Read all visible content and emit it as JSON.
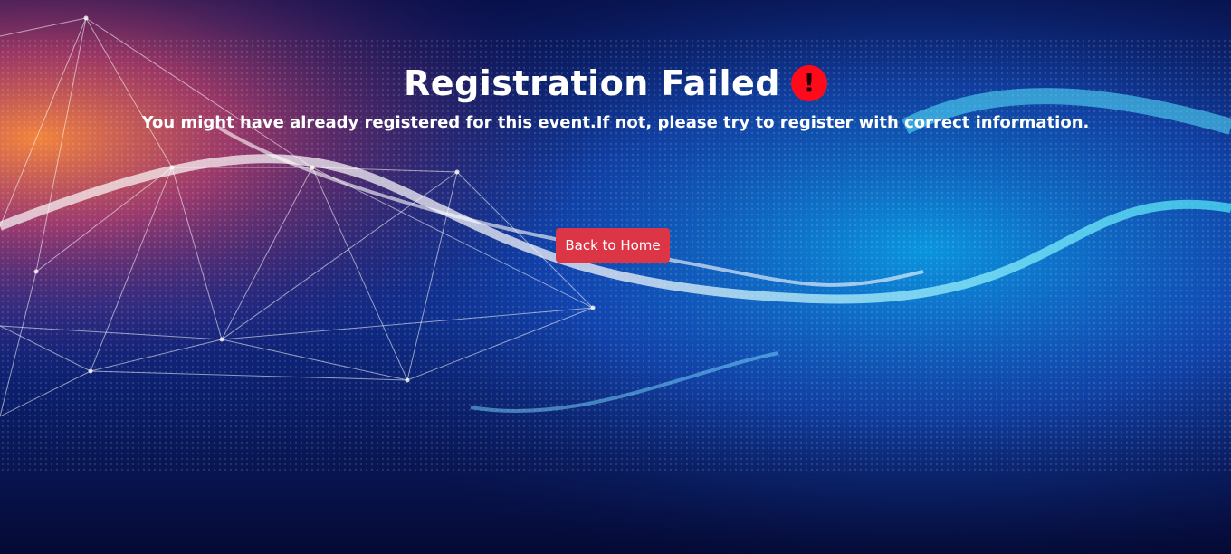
{
  "heading": {
    "title": "Registration Failed",
    "alert_icon": "exclamation-circle-icon",
    "alert_symbol": "!",
    "alert_color": "#ff0a1a"
  },
  "message": {
    "text": "You might have already registered for this event.If not, please try to register with correct information."
  },
  "actions": {
    "back_home_label": "Back to Home",
    "button_color": "#dc3545"
  }
}
